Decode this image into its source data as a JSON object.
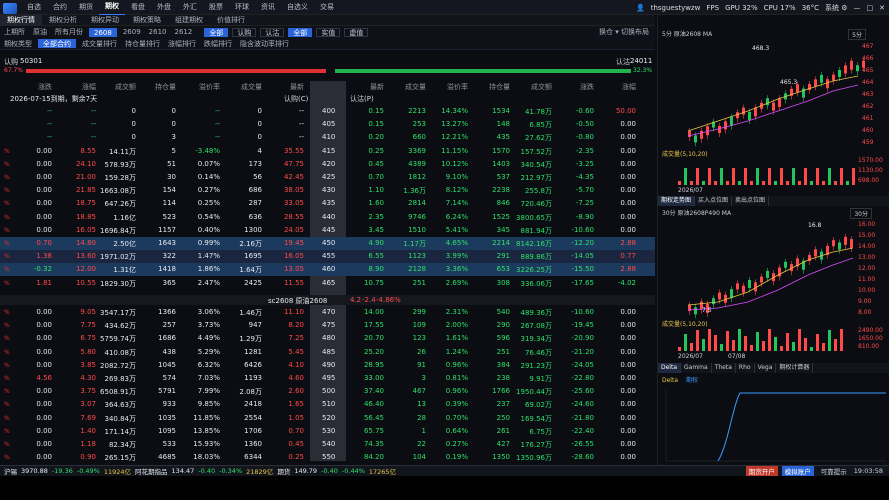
{
  "topbar": {
    "menu": [
      "自选",
      "合约",
      "期货",
      "期权",
      "看盘",
      "外盘",
      "外汇",
      "股票",
      "环球",
      "资讯",
      "自选义",
      "交易"
    ],
    "active": 3,
    "user": "thsguestywzw",
    "fps": "FPS",
    "gpu": "GPU 32%",
    "cpu": "CPU 17%",
    "temp": "36°C",
    "sys": "系统 ⚙"
  },
  "subtabs": {
    "items": [
      "期权行情",
      "期权分析",
      "期权异动",
      "期权策略",
      "组建期权",
      "价值排行"
    ],
    "active": 0
  },
  "filters": {
    "items": [
      "上期所",
      "原油",
      "所有月份",
      "2608",
      "2609",
      "2610",
      "2612"
    ],
    "selected": "2608",
    "chips": [
      "全部",
      "认购",
      "认沽",
      "全部",
      "实值",
      "虚值"
    ],
    "selected_chip": "全部",
    "right": "换仓 ▾ 切换布局"
  },
  "filters2": {
    "items": [
      "期权类型",
      "全部合约",
      "成交量排行",
      "持仓量排行",
      "涨幅排行",
      "跌幅排行",
      "隐含波动率排行"
    ],
    "selected": "全部合约"
  },
  "summary": {
    "call_label": "认购",
    "call_value": "50301",
    "put_label": "认沽",
    "put_value": "24011",
    "call_ratio": "67.7%",
    "put_ratio": "32.3%"
  },
  "header": {
    "call_cols": [
      "涨跌",
      "涨幅",
      "成交额",
      "持仓量",
      "溢价率",
      "成交量",
      "最新"
    ],
    "strike": "行权价",
    "put_cols": [
      "最新",
      "成交量",
      "溢价率",
      "持仓量",
      "成交额",
      "涨跌",
      "涨幅"
    ],
    "expiry": "2026-07-15到期，剩余7天",
    "call_tag": "认购(C)",
    "put_tag": "认沽(P)"
  },
  "rows": [
    {
      "strike": "400",
      "c": [
        "--",
        "--",
        "0",
        "0",
        "--",
        "0",
        "--"
      ],
      "p": [
        "0.15",
        "2213",
        "14.34%",
        "1534",
        "41.78万",
        "-0.60",
        "50.00"
      ],
      "cpct": false
    },
    {
      "strike": "405",
      "c": [
        "--",
        "--",
        "0",
        "0",
        "--",
        "0",
        "--"
      ],
      "p": [
        "0.15",
        "253",
        "13.27%",
        "148",
        "6.85万",
        "-0.50",
        "0.00"
      ],
      "cpct": false
    },
    {
      "strike": "410",
      "c": [
        "--",
        "--",
        "0",
        "3",
        "--",
        "0",
        "--"
      ],
      "p": [
        "0.20",
        "660",
        "12.21%",
        "435",
        "27.62万",
        "-0.80",
        "0.00"
      ],
      "cpct": false
    },
    {
      "strike": "415",
      "c": [
        "0.00",
        "8.55",
        "14.11万",
        "5",
        "-3.48%",
        "4",
        "35.55"
      ],
      "p": [
        "0.25",
        "3369",
        "11.15%",
        "1570",
        "157.52万",
        "-2.35",
        "0.00"
      ],
      "cpct": true
    },
    {
      "strike": "420",
      "c": [
        "0.00",
        "24.10",
        "578.93万",
        "51",
        "0.07%",
        "173",
        "47.75"
      ],
      "p": [
        "0.45",
        "4389",
        "10.12%",
        "1403",
        "340.54万",
        "-3.25",
        "0.00"
      ],
      "cpct": true
    },
    {
      "strike": "425",
      "c": [
        "0.00",
        "21.00",
        "159.28万",
        "30",
        "0.14%",
        "56",
        "42.45"
      ],
      "p": [
        "0.70",
        "1812",
        "9.10%",
        "537",
        "212.97万",
        "-4.35",
        "0.00"
      ],
      "cpct": true
    },
    {
      "strike": "430",
      "c": [
        "0.00",
        "21.85",
        "1663.08万",
        "154",
        "0.27%",
        "686",
        "38.05"
      ],
      "p": [
        "1.10",
        "1.36万",
        "8.12%",
        "2238",
        "255.8万",
        "-5.70",
        "0.00"
      ],
      "cpct": true
    },
    {
      "strike": "435",
      "c": [
        "0.00",
        "18.75",
        "647.26万",
        "114",
        "0.25%",
        "287",
        "33.05"
      ],
      "p": [
        "1.60",
        "2814",
        "7.14%",
        "846",
        "720.46万",
        "-7.25",
        "0.00"
      ],
      "cpct": true
    },
    {
      "strike": "440",
      "c": [
        "0.00",
        "18.85",
        "1.16亿",
        "523",
        "0.54%",
        "636",
        "28.55"
      ],
      "p": [
        "2.35",
        "9746",
        "6.24%",
        "1525",
        "3800.65万",
        "-8.90",
        "0.00"
      ],
      "cpct": true
    },
    {
      "strike": "445",
      "c": [
        "0.00",
        "16.05",
        "1696.84万",
        "1157",
        "0.40%",
        "1300",
        "24.05"
      ],
      "p": [
        "3.45",
        "1510",
        "5.41%",
        "345",
        "881.94万",
        "-10.60",
        "0.00"
      ],
      "cpct": true
    },
    {
      "strike": "450",
      "c": [
        "0.70",
        "14.80",
        "2.50亿",
        "1643",
        "0.99%",
        "2.16万",
        "19.45"
      ],
      "p": [
        "4.90",
        "1.17万",
        "4.65%",
        "2214",
        "8142.16万",
        "-12.20",
        "2.88"
      ],
      "cpct": true
    },
    {
      "strike": "455",
      "c": [
        "1.38",
        "13.60",
        "1971.02万",
        "322",
        "1.47%",
        "1695",
        "16.05"
      ],
      "p": [
        "6.55",
        "1123",
        "3.99%",
        "291",
        "889.86万",
        "-14.05",
        "0.77"
      ],
      "cpct": true
    },
    {
      "strike": "460",
      "c": [
        "-0.32",
        "12.00",
        "1.31亿",
        "1418",
        "1.86%",
        "1.64万",
        "13.05"
      ],
      "p": [
        "8.90",
        "2128",
        "3.36%",
        "653",
        "3226.25万",
        "-15.50",
        "2.88"
      ],
      "cpct": true
    },
    {
      "strike": "465",
      "c": [
        "1.81",
        "10.55",
        "1829.30万",
        "365",
        "2.47%",
        "2425",
        "11.55"
      ],
      "p": [
        "10.75",
        "251",
        "2.69%",
        "308",
        "336.06万",
        "-17.65",
        "-4.02"
      ],
      "cpct": true
    },
    {
      "strike": "470",
      "c": [
        "0.00",
        "9.05",
        "3547.17万",
        "1366",
        "3.06%",
        "1.46万",
        "11.10"
      ],
      "p": [
        "14.00",
        "299",
        "2.31%",
        "540",
        "489.36万",
        "-10.60",
        "0.00"
      ],
      "cpct": true
    },
    {
      "strike": "475",
      "c": [
        "0.00",
        "7.75",
        "434.62万",
        "257",
        "3.73%",
        "947",
        "8.20"
      ],
      "p": [
        "17.55",
        "109",
        "2.00%",
        "290",
        "267.08万",
        "-19.45",
        "0.00"
      ],
      "cpct": true
    },
    {
      "strike": "480",
      "c": [
        "0.00",
        "6.75",
        "5759.74万",
        "1686",
        "4.49%",
        "1.29万",
        "7.25"
      ],
      "p": [
        "20.70",
        "123",
        "1.61%",
        "596",
        "319.34万",
        "-20.90",
        "0.00"
      ],
      "cpct": true
    },
    {
      "strike": "485",
      "c": [
        "0.00",
        "5.80",
        "410.08万",
        "438",
        "5.29%",
        "1281",
        "5.45"
      ],
      "p": [
        "25.20",
        "26",
        "1.24%",
        "251",
        "76.46万",
        "-21.20",
        "0.00"
      ],
      "cpct": true
    },
    {
      "strike": "490",
      "c": [
        "0.00",
        "3.85",
        "2082.72万",
        "1045",
        "6.32%",
        "6426",
        "4.10"
      ],
      "p": [
        "28.95",
        "91",
        "0.96%",
        "384",
        "291.23万",
        "-24.05",
        "0.00"
      ],
      "cpct": true
    },
    {
      "strike": "495",
      "c": [
        "4.56",
        "4.30",
        "269.83万",
        "574",
        "7.03%",
        "1193",
        "4.60"
      ],
      "p": [
        "33.00",
        "3",
        "0.81%",
        "238",
        "9.91万",
        "-22.80",
        "0.00"
      ],
      "cpct": true
    },
    {
      "strike": "500",
      "c": [
        "0.00",
        "3.75",
        "6508.91万",
        "5791",
        "7.99%",
        "2.08万",
        "2.60"
      ],
      "p": [
        "37.40",
        "467",
        "0.96%",
        "1766",
        "1950.44万",
        "-25.60",
        "0.00"
      ],
      "cpct": true
    },
    {
      "strike": "510",
      "c": [
        "0.00",
        "3.07",
        "364.63万",
        "933",
        "9.85%",
        "2418",
        "1.65"
      ],
      "p": [
        "46.40",
        "13",
        "0.39%",
        "237",
        "69.02万",
        "-24.60",
        "0.00"
      ],
      "cpct": true
    },
    {
      "strike": "520",
      "c": [
        "0.00",
        "7.69",
        "340.84万",
        "1035",
        "11.85%",
        "2554",
        "1.05"
      ],
      "p": [
        "56.45",
        "28",
        "0.70%",
        "250",
        "169.54万",
        "-21.80",
        "0.00"
      ],
      "cpct": true
    },
    {
      "strike": "530",
      "c": [
        "0.00",
        "1.40",
        "171.14万",
        "1095",
        "13.85%",
        "1706",
        "0.70"
      ],
      "p": [
        "65.75",
        "1",
        "0.64%",
        "261",
        "6.75万",
        "-22.40",
        "0.00"
      ],
      "cpct": true
    },
    {
      "strike": "540",
      "c": [
        "0.00",
        "1.18",
        "82.34万",
        "533",
        "15.93%",
        "1360",
        "0.45"
      ],
      "p": [
        "74.35",
        "22",
        "0.27%",
        "427",
        "176.27万",
        "-26.55",
        "0.00"
      ],
      "cpct": true
    },
    {
      "strike": "550",
      "c": [
        "0.00",
        "0.90",
        "265.15万",
        "4685",
        "18.03%",
        "6344",
        "0.25"
      ],
      "p": [
        "84.20",
        "104",
        "0.19%",
        "1350",
        "1350.96万",
        "-28.60",
        "0.00"
      ],
      "cpct": true
    }
  ],
  "underlying_row": {
    "label": "sc2608 原油2608",
    "price": "4.2",
    "change": "-2.4",
    "pct": "-4.86%"
  },
  "right_panel": {
    "top_title": "5分 原油2608  MA",
    "top_period": "5分",
    "top_high": "468.3",
    "top_low": "465.3",
    "top_price_axis": [
      "467",
      "466",
      "465",
      "464",
      "463",
      "462",
      "461",
      "460",
      "459"
    ],
    "vol_title": "成交量(5,10,20)",
    "vol_axis": [
      "1570.00",
      "1130.00",
      "698.00"
    ],
    "date_top": "2026/07",
    "tabs": [
      "期权走势图",
      "买入点位图",
      "卖出点位图"
    ],
    "opt_title": "30分 原油2608P490 MA",
    "opt_period": "30分",
    "opt_high": "16.8",
    "opt_low": "7.5",
    "opt_axis": [
      "16.00",
      "15.00",
      "14.00",
      "13.00",
      "12.00",
      "11.00",
      "10.00",
      "9.00",
      "8.00"
    ],
    "vol2_title": "成交量(5,10,20)",
    "vol2_axis": [
      "2490.00",
      "1650.00",
      "810.00"
    ],
    "date2": [
      "2026/07",
      "07/08"
    ],
    "greek_tabs": [
      "Delta",
      "Gamma",
      "Theta",
      "Rho",
      "Vega",
      "期权计算器"
    ],
    "greek_legend": [
      "Delta",
      "期权"
    ]
  },
  "status": {
    "items": [
      "沪锡",
      "3970.88",
      "-19.36",
      "-0.49%",
      "11924亿",
      "阿花期指品",
      "134.47",
      "-0.40",
      "-0.34%",
      "21829亿",
      "期货",
      "149.79",
      "-0.40",
      "-0.44%",
      "17265亿"
    ],
    "btn1": "期货开户",
    "btn2": "模拟账户",
    "btn3": "可靠提示",
    "time": "19:03:58"
  },
  "colors": {
    "red": "#ff4a4a",
    "green": "#2ee06a",
    "accent": "#2a64d8",
    "highlight": "#1b3a5e"
  }
}
